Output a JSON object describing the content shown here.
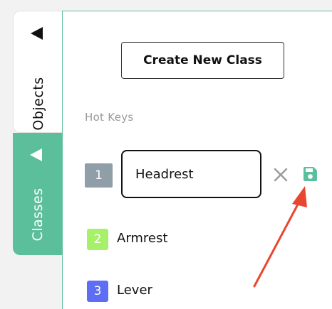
{
  "tabs": [
    {
      "label": "Objects",
      "icon": "triangle-left-icon",
      "active": false
    },
    {
      "label": "Classes",
      "icon": "triangle-left-icon",
      "active": true
    }
  ],
  "panel": {
    "create_button_label": "Create New Class",
    "section_label": "Hot Keys",
    "editing_row": {
      "key": "1",
      "value": "Headrest",
      "badge_color": "#8f9ea7"
    },
    "rows": [
      {
        "key": "2",
        "label": "Armrest",
        "color": "#a6f06a"
      },
      {
        "key": "3",
        "label": "Lever",
        "color": "#5d6ef5"
      }
    ]
  },
  "colors": {
    "accent": "#5cbf9b",
    "annotation_arrow": "#e8472f",
    "close_icon": "#9a9a9a"
  }
}
